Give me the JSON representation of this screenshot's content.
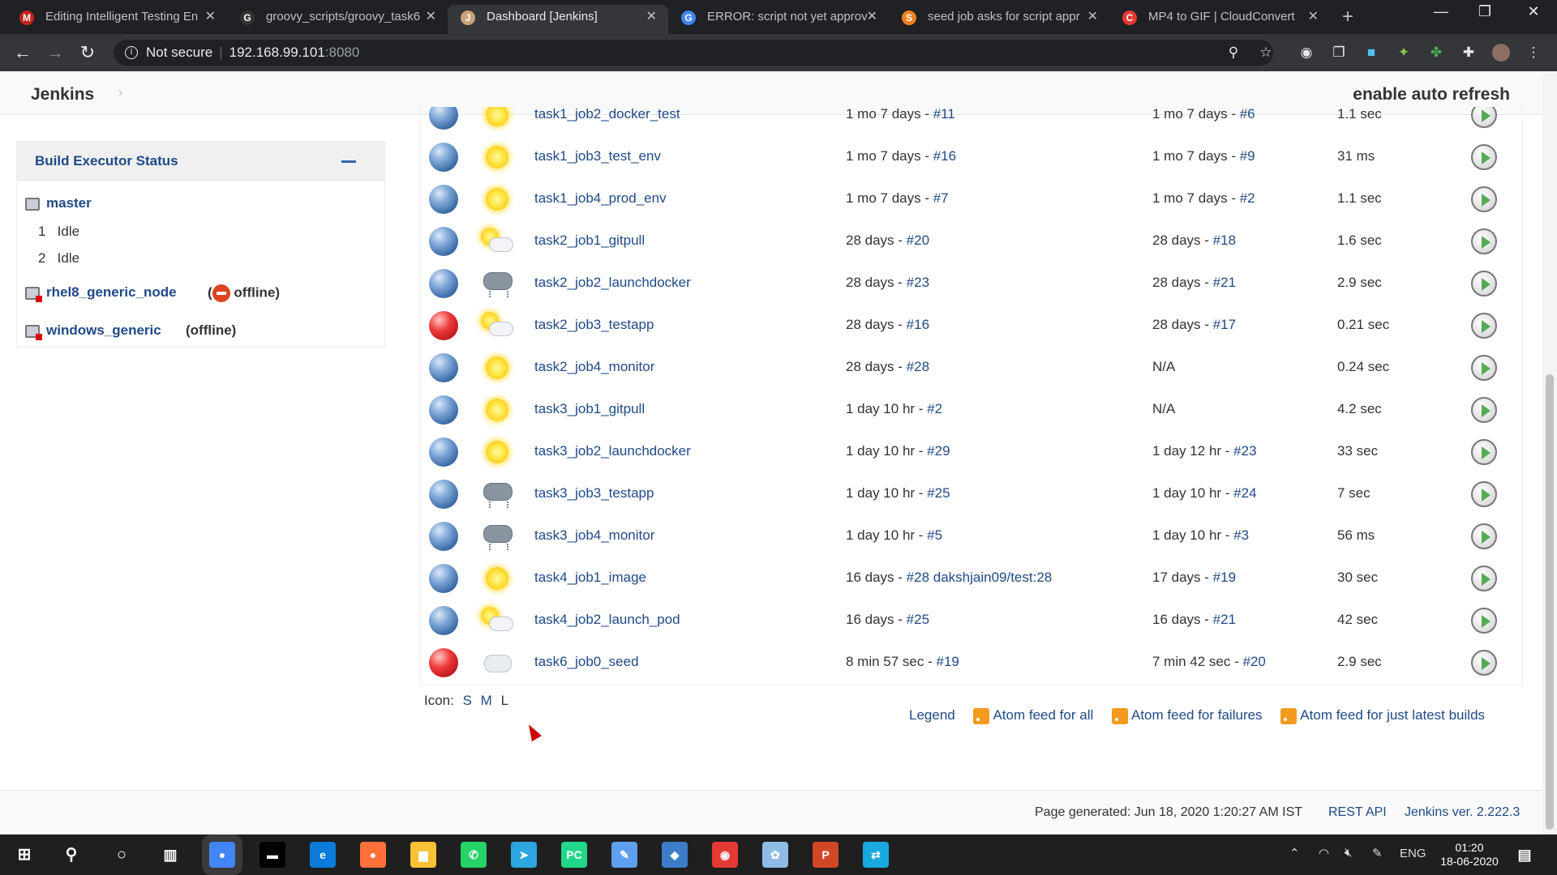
{
  "browser": {
    "tabs": [
      {
        "label": "Editing Intelligent Testing En",
        "icon": "gmail-icon",
        "color": "#c5221f",
        "glyph": "M"
      },
      {
        "label": "groovy_scripts/groovy_task6",
        "icon": "github-icon",
        "color": "#333333",
        "glyph": "G"
      },
      {
        "label": "Dashboard [Jenkins]",
        "icon": "jenkins-icon",
        "color": "#c9a27a",
        "glyph": "J"
      },
      {
        "label": "ERROR: script not yet approv",
        "icon": "google-icon",
        "color": "#4285f4",
        "glyph": "G"
      },
      {
        "label": "seed job asks for script appr",
        "icon": "stackoverflow-icon",
        "color": "#f48024",
        "glyph": "S"
      },
      {
        "label": "MP4 to GIF | CloudConvert",
        "icon": "cloudconvert-icon",
        "color": "#e53935",
        "glyph": "C"
      }
    ],
    "active_tab_index": 2,
    "security_label": "Not secure",
    "url_host": "192.168.99.101",
    "url_port": ":8080"
  },
  "header": {
    "title": "Jenkins",
    "auto_refresh": "enable auto refresh"
  },
  "executors": {
    "title": "Build Executor Status",
    "master": {
      "name": "master",
      "slots": [
        {
          "num": "1",
          "state": "Idle"
        },
        {
          "num": "2",
          "state": "Idle"
        }
      ]
    },
    "nodes": [
      {
        "name": "rhel8_generic_node",
        "status_prefix": "(",
        "status": "offline)"
      },
      {
        "name": "windows_generic",
        "status_prefix": "",
        "status": "(offline)"
      }
    ]
  },
  "jobs": [
    {
      "name": "task1_job2_docker_test",
      "status": "blue",
      "weather": "sunny",
      "last_success": "1 mo 7 days - ",
      "last_success_build": "#11",
      "last_failure": "1 mo 7 days - ",
      "last_failure_build": "#6",
      "duration": "1.1 sec"
    },
    {
      "name": "task1_job3_test_env",
      "status": "blue",
      "weather": "sunny",
      "last_success": "1 mo 7 days - ",
      "last_success_build": "#16",
      "last_failure": "1 mo 7 days - ",
      "last_failure_build": "#9",
      "duration": "31 ms"
    },
    {
      "name": "task1_job4_prod_env",
      "status": "blue",
      "weather": "sunny",
      "last_success": "1 mo 7 days - ",
      "last_success_build": "#7",
      "last_failure": "1 mo 7 days - ",
      "last_failure_build": "#2",
      "duration": "1.1 sec"
    },
    {
      "name": "task2_job1_gitpull",
      "status": "blue",
      "weather": "partly",
      "last_success": "28 days - ",
      "last_success_build": "#20",
      "last_failure": "28 days - ",
      "last_failure_build": "#18",
      "duration": "1.6 sec"
    },
    {
      "name": "task2_job2_launchdocker",
      "status": "blue",
      "weather": "storm",
      "last_success": "28 days - ",
      "last_success_build": "#23",
      "last_failure": "28 days - ",
      "last_failure_build": "#21",
      "duration": "2.9 sec"
    },
    {
      "name": "task2_job3_testapp",
      "status": "red",
      "weather": "partly",
      "last_success": "28 days - ",
      "last_success_build": "#16",
      "last_failure": "28 days - ",
      "last_failure_build": "#17",
      "duration": "0.21 sec"
    },
    {
      "name": "task2_job4_monitor",
      "status": "blue",
      "weather": "sunny",
      "last_success": "28 days - ",
      "last_success_build": "#28",
      "last_failure": "N/A",
      "last_failure_build": "",
      "duration": "0.24 sec"
    },
    {
      "name": "task3_job1_gitpull",
      "status": "blue",
      "weather": "sunny",
      "last_success": "1 day 10 hr - ",
      "last_success_build": "#2",
      "last_failure": "N/A",
      "last_failure_build": "",
      "duration": "4.2 sec"
    },
    {
      "name": "task3_job2_launchdocker",
      "status": "blue",
      "weather": "sunny",
      "last_success": "1 day 10 hr - ",
      "last_success_build": "#29",
      "last_failure": "1 day 12 hr - ",
      "last_failure_build": "#23",
      "duration": "33 sec"
    },
    {
      "name": "task3_job3_testapp",
      "status": "blue",
      "weather": "storm",
      "last_success": "1 day 10 hr - ",
      "last_success_build": "#25",
      "last_failure": "1 day 10 hr - ",
      "last_failure_build": "#24",
      "duration": "7 sec"
    },
    {
      "name": "task3_job4_monitor",
      "status": "blue",
      "weather": "storm",
      "last_success": "1 day 10 hr - ",
      "last_success_build": "#5",
      "last_failure": "1 day 10 hr - ",
      "last_failure_build": "#3",
      "duration": "56 ms"
    },
    {
      "name": "task4_job1_image",
      "status": "blue",
      "weather": "sunny",
      "last_success": "16 days - ",
      "last_success_build": "#28 dakshjain09/test:28",
      "last_failure": "17 days - ",
      "last_failure_build": "#19",
      "duration": "30 sec"
    },
    {
      "name": "task4_job2_launch_pod",
      "status": "blue",
      "weather": "partly",
      "last_success": "16 days - ",
      "last_success_build": "#25",
      "last_failure": "16 days - ",
      "last_failure_build": "#21",
      "duration": "42 sec"
    },
    {
      "name": "task6_job0_seed",
      "status": "red",
      "weather": "cloudy",
      "last_success": "8 min 57 sec - ",
      "last_success_build": "#19",
      "last_failure": "7 min 42 sec - ",
      "last_failure_build": "#20",
      "duration": "2.9 sec"
    }
  ],
  "icon_size": {
    "label": "Icon:",
    "s": "S",
    "m": "M",
    "l": "L"
  },
  "feeds": {
    "legend": "Legend",
    "all": "Atom feed for all",
    "failures": "Atom feed for failures",
    "latest": "Atom feed for just latest builds"
  },
  "footer": {
    "page_generated": "Page generated: Jun 18, 2020 1:20:27 AM IST",
    "rest_api": "REST API",
    "jenkins_version": "Jenkins ver. 2.222.3"
  },
  "taskbar": {
    "apps": [
      {
        "name": "chrome-icon",
        "color": "#4285f4",
        "glyph": "●"
      },
      {
        "name": "terminal-icon",
        "color": "#000000",
        "glyph": "▬"
      },
      {
        "name": "edge-icon",
        "color": "#0a7bd8",
        "glyph": "e"
      },
      {
        "name": "firefox-icon",
        "color": "#ff7139",
        "glyph": "●"
      },
      {
        "name": "file-explorer-icon",
        "color": "#f8c234",
        "glyph": "▆"
      },
      {
        "name": "whatsapp-icon",
        "color": "#25d366",
        "glyph": "✆"
      },
      {
        "name": "telegram-icon",
        "color": "#2ca5e0",
        "glyph": "➤"
      },
      {
        "name": "pycharm-icon",
        "color": "#21d789",
        "glyph": "PC"
      },
      {
        "name": "notepad-icon",
        "color": "#5ea0ef",
        "glyph": "✎"
      },
      {
        "name": "virtualbox-icon",
        "color": "#3d7cc9",
        "glyph": "◆"
      },
      {
        "name": "red-app-icon",
        "color": "#e53935",
        "glyph": "◉"
      },
      {
        "name": "paint-icon",
        "color": "#8fbce6",
        "glyph": "✿"
      },
      {
        "name": "powerpoint-icon",
        "color": "#d24726",
        "glyph": "P"
      },
      {
        "name": "quick-assist-icon",
        "color": "#18a9e0",
        "glyph": "⇄"
      }
    ],
    "language": "ENG",
    "time": "01:20",
    "date": "18-06-2020"
  }
}
